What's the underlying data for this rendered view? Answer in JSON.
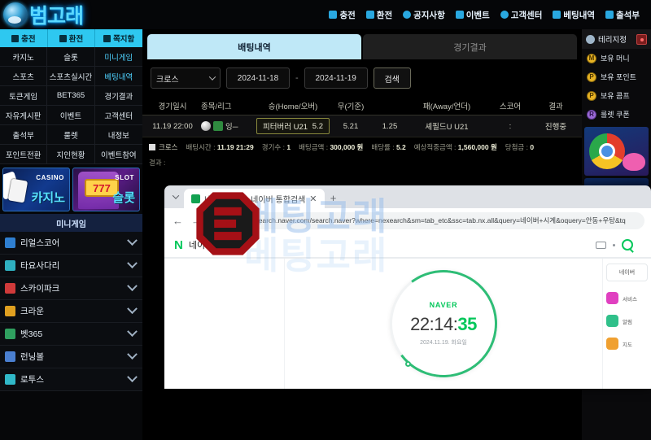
{
  "site": {
    "logo_text": "범고래",
    "topnav": [
      {
        "label": "충전",
        "icon": "deposit-icon"
      },
      {
        "label": "환전",
        "icon": "withdraw-icon"
      },
      {
        "label": "공지사항",
        "icon": "notice-icon"
      },
      {
        "label": "이벤트",
        "icon": "event-icon"
      },
      {
        "label": "고객센터",
        "icon": "support-icon"
      },
      {
        "label": "베팅내역",
        "icon": "bet-history-icon"
      },
      {
        "label": "출석부",
        "icon": "attendance-icon"
      }
    ]
  },
  "sidebar": {
    "quick": [
      {
        "label": "충전",
        "icon": "deposit-icon"
      },
      {
        "label": "환전",
        "icon": "withdraw-icon"
      },
      {
        "label": "쪽지함",
        "icon": "message-icon"
      }
    ],
    "menu": [
      {
        "label": "카지노"
      },
      {
        "label": "슬롯"
      },
      {
        "label": "미니게임",
        "hl": true
      },
      {
        "label": "스포츠"
      },
      {
        "label": "스포츠실시간"
      },
      {
        "label": "베팅내역",
        "hl": true
      },
      {
        "label": "토큰게임"
      },
      {
        "label": "BET365"
      },
      {
        "label": "경기결과"
      },
      {
        "label": "자유게시판"
      },
      {
        "label": "이벤트"
      },
      {
        "label": "고객센터"
      },
      {
        "label": "출석부"
      },
      {
        "label": "룰렛"
      },
      {
        "label": "내정보"
      },
      {
        "label": "포인트전환"
      },
      {
        "label": "지인현황"
      },
      {
        "label": "이벤트참여"
      }
    ],
    "banners": [
      {
        "en": "CASINO",
        "ko": "카지노"
      },
      {
        "en": "SLOT",
        "ko": "슬롯",
        "reel": "777"
      }
    ],
    "minigame_title": "미니게임",
    "minigames": [
      {
        "label": "리얼스코어",
        "color": "#2f7fd0"
      },
      {
        "label": "타요사다리",
        "color": "#2fb0c0"
      },
      {
        "label": "스카이파크",
        "color": "#d03a3a"
      },
      {
        "label": "크라운",
        "color": "#e0a020"
      },
      {
        "label": "벳365",
        "color": "#2f9f5f"
      },
      {
        "label": "런닝볼",
        "color": "#4a7fd0"
      },
      {
        "label": "로투스",
        "color": "#30b8c8"
      }
    ]
  },
  "main": {
    "tabs": [
      {
        "label": "배팅내역",
        "active": true
      },
      {
        "label": "경기결과",
        "active": false
      }
    ],
    "filter": {
      "type_value": "크로스",
      "date_from": "2024-11-18",
      "date_to": "2024-11-19",
      "separator": "-",
      "search_label": "검색"
    },
    "table": {
      "headers": [
        "경기일시",
        "종목/리그",
        "승(Home/오버)",
        "무(기준)",
        "패(Away/언더)",
        "스코어",
        "결과"
      ],
      "rows": [
        {
          "date": "11.19 22:00",
          "league": "잉─",
          "home_team": "피터버러 U21",
          "home_odds": "5.2",
          "draw": "5.21",
          "handicap": "1.25",
          "away_team": "셰필드U U21",
          "score": ":",
          "result": "진행중"
        }
      ]
    },
    "summary": {
      "type": "크로스",
      "time_label": "배팅시간 :",
      "time_value": "11.19 21:29",
      "count_label": "경기수 :",
      "count_value": "1",
      "amount_label": "배팅금액 :",
      "amount_value": "300,000 원",
      "odds_label": "배당률 :",
      "odds_value": "5.2",
      "expected_label": "예상적중금액 :",
      "expected_value": "1,560,000 원",
      "win_label": "당첨금 :",
      "win_value": "0",
      "result_line": "결과 :"
    }
  },
  "right_panel": {
    "user_name": "테리지정",
    "balances": [
      {
        "label": "보유 머니",
        "icon": "money-coin-icon",
        "symbol": "M"
      },
      {
        "label": "보유 포인트",
        "icon": "point-coin-icon",
        "symbol": "P"
      },
      {
        "label": "보유 콤프",
        "icon": "comp-coin-icon",
        "symbol": "P"
      },
      {
        "label": "룰렛 쿠폰",
        "icon": "roulette-coupon-icon",
        "symbol": "R"
      }
    ]
  },
  "browser": {
    "tab_title": "네이버 시계 : 네이버 통합검색",
    "tab_close": "✕",
    "new_tab": "+",
    "back": "←",
    "forward": "→",
    "reload": "⟳",
    "url": "https://search.naver.com/search.naver?where=nexearch&sm=tab_etc&ssc=tab.nx.all&query=네이버+시계&oquery=안동+우탕&tq",
    "naver": {
      "logo": "N",
      "query": "네이버 시계",
      "search_icon": "search-icon",
      "keyboard_icon": "keyboard-icon",
      "clock": {
        "brand": "NAVER",
        "hm": "22:14:",
        "sec": "35",
        "date": "2024.11.19. 화요일"
      },
      "right_box": "네이버",
      "right_items": [
        {
          "color": "#e040c0",
          "text": "서비스"
        },
        {
          "color": "#30c08a",
          "text": "알림"
        },
        {
          "color": "#f0a030",
          "text": "지도"
        }
      ]
    }
  },
  "watermark": {
    "line1": "베팅고래",
    "line2": "베팅고래",
    "logo": "B3"
  }
}
